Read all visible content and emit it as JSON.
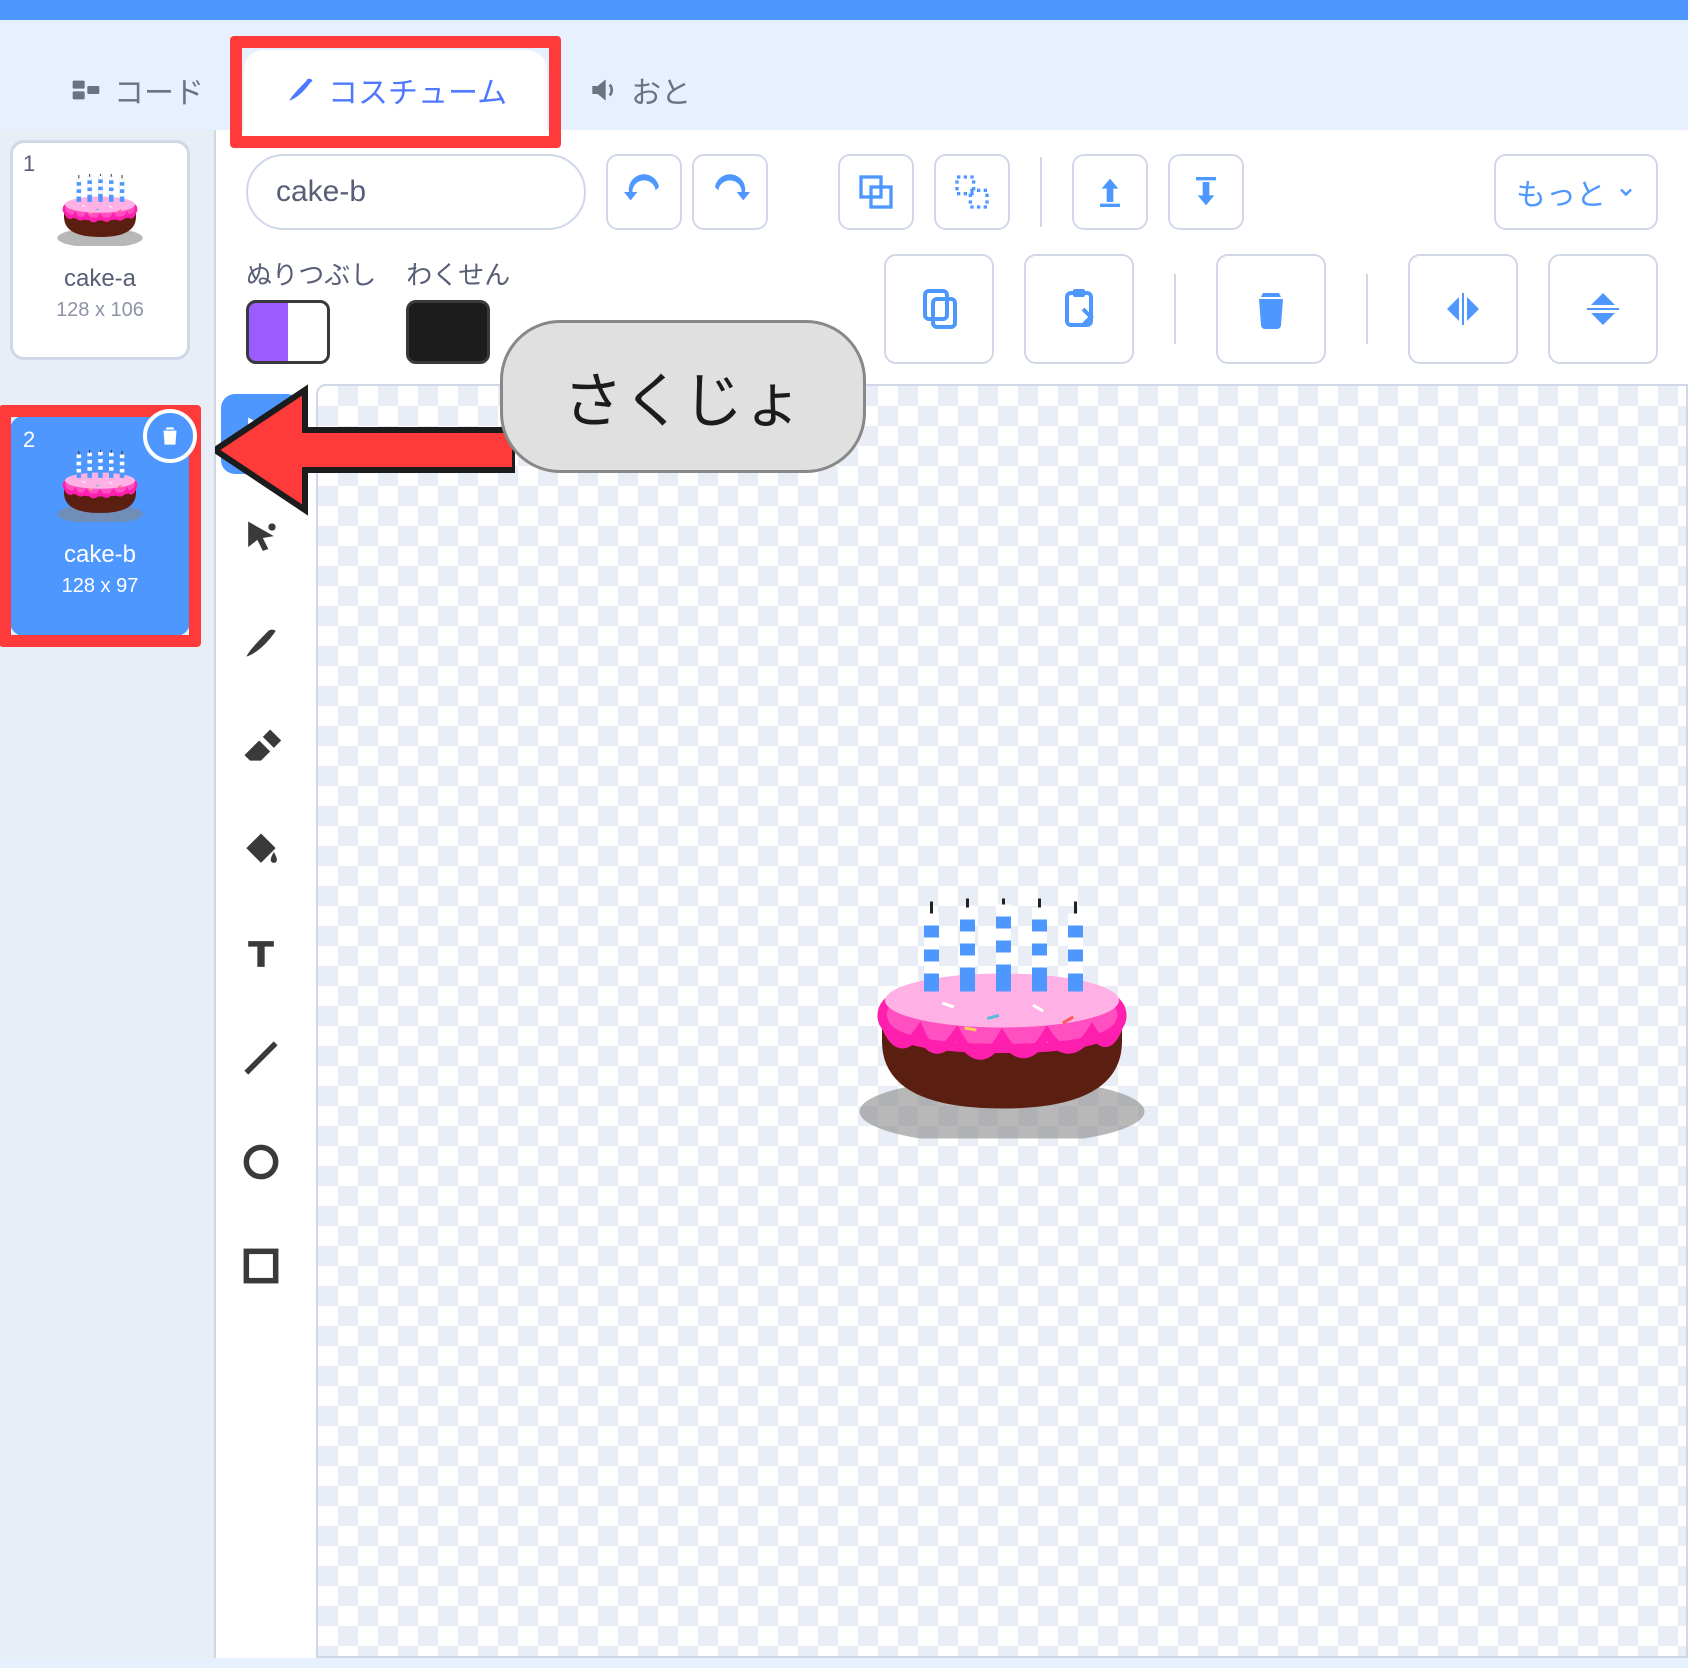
{
  "tabs": {
    "code": "コード",
    "costumes": "コスチューム",
    "sound": "おと"
  },
  "costumeList": [
    {
      "num": "1",
      "name": "cake-a",
      "dims": "128 x 106"
    },
    {
      "num": "2",
      "name": "cake-b",
      "dims": "128 x 97"
    }
  ],
  "editor": {
    "costumeName": "cake-b",
    "fillLabel": "ぬりつぶし",
    "outlineLabel": "わくせん",
    "more": "もっと"
  },
  "annotation": {
    "text": "さくじょ"
  }
}
